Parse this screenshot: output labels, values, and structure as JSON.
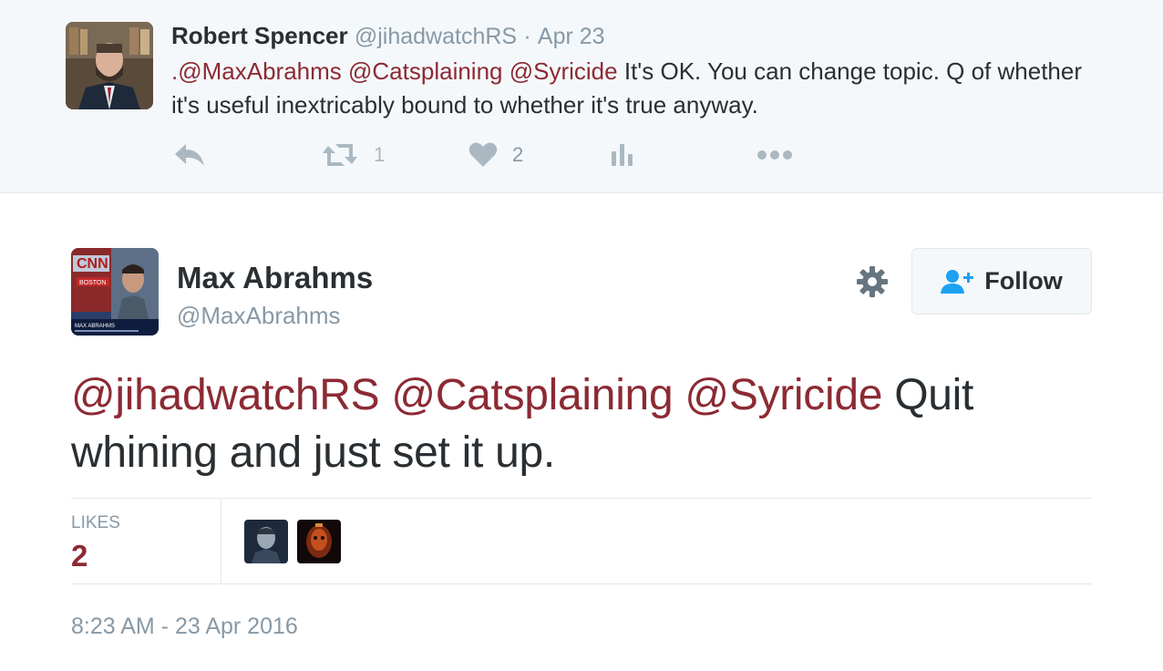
{
  "parent_tweet": {
    "fullname": "Robert Spencer",
    "screen_name": "@jihadwatchRS",
    "separator": "·",
    "date": "Apr 23",
    "mentions": [
      ".@MaxAbrahms",
      "@Catsplaining",
      "@Syricide"
    ],
    "text": "It's OK. You can change topic. Q of whether it's useful inextricably bound to whether it's true anyway.",
    "actions": {
      "reply_icon": "reply-icon",
      "retweet_icon": "retweet-icon",
      "retweet_count": "1",
      "like_icon": "heart-icon",
      "like_count": "2",
      "analytics_icon": "analytics-icon",
      "more_icon": "more-dots-icon"
    }
  },
  "main_tweet": {
    "fullname": "Max Abrahms",
    "screen_name": "@MaxAbrahms",
    "follow_label": "Follow",
    "mentions": [
      "@jihadwatchRS",
      "@Catsplaining",
      "@Syricide"
    ],
    "text": "Quit whining and just set it up.",
    "likes_label": "LIKES",
    "likes_count": "2",
    "timestamp": "8:23 AM - 23 Apr 2016"
  },
  "colors": {
    "mention": "#8c2a34",
    "muted": "#8899a6",
    "text": "#292f33",
    "follow_icon": "#1da1f2",
    "parent_bg": "#f5f8fa",
    "border": "#e1e8ed"
  }
}
